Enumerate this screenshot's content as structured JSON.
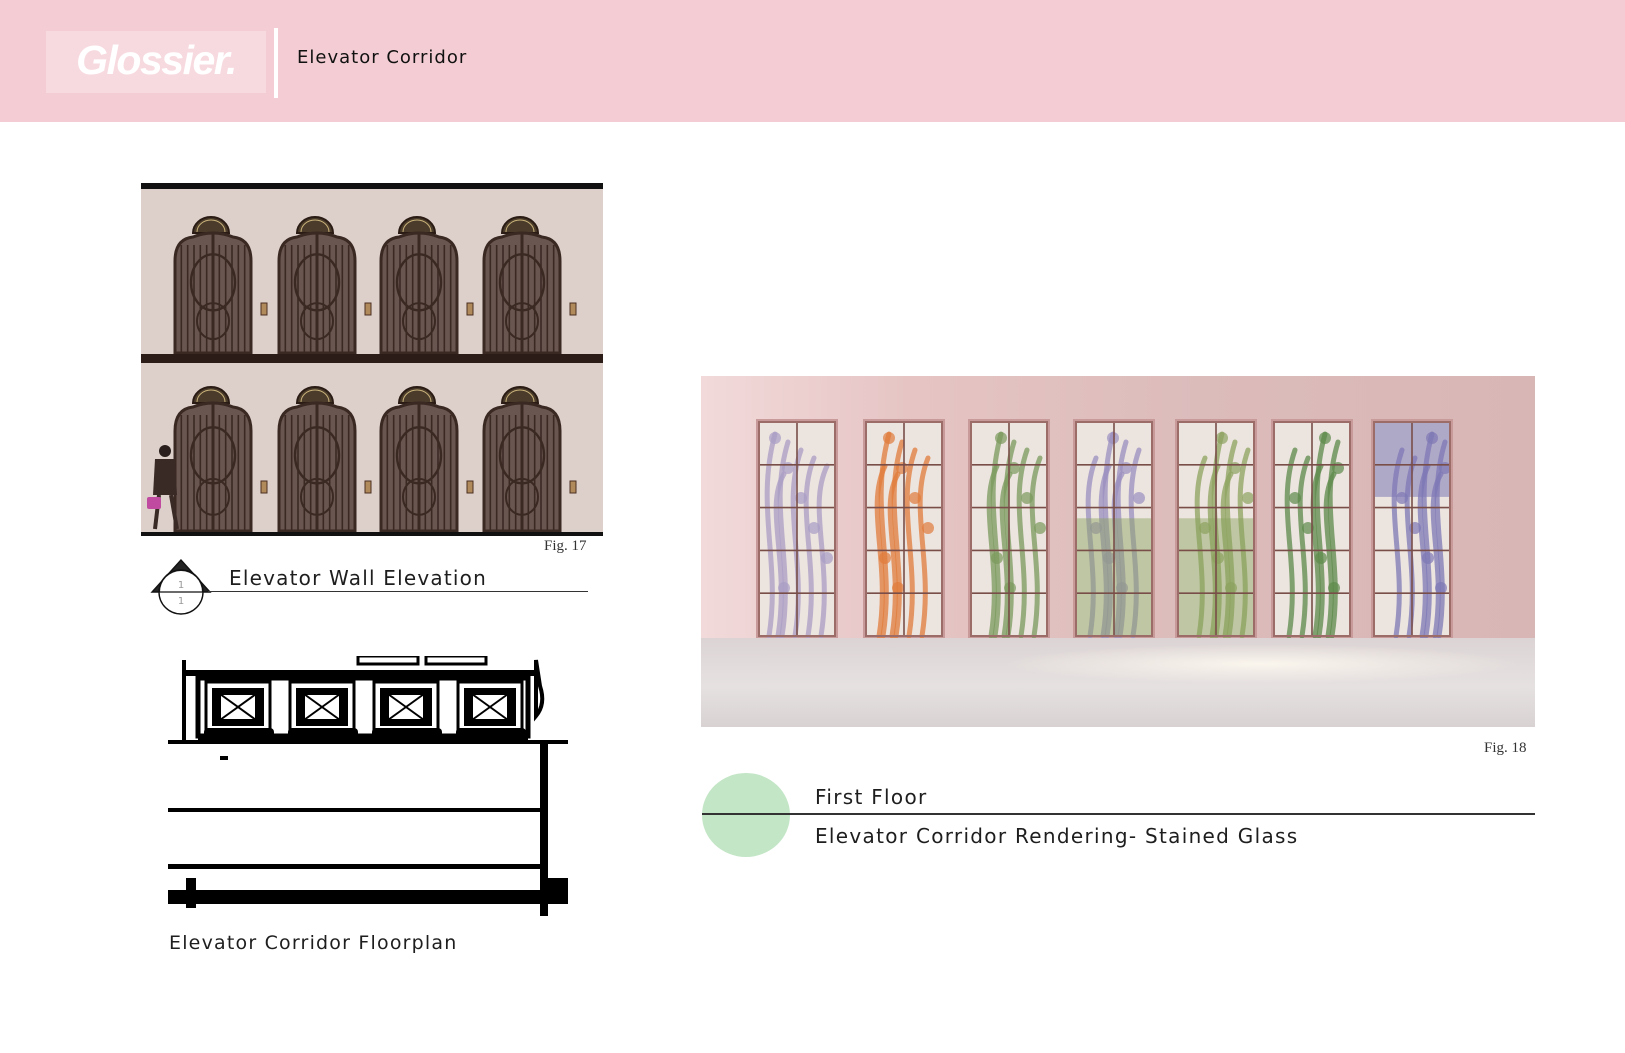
{
  "header": {
    "logo": "Glossier.",
    "title": "Elevator Corridor"
  },
  "elevation": {
    "figure_label": "Fig. 17",
    "title": "Elevator Wall Elevation",
    "section_marker": {
      "top": "1",
      "bottom": "1"
    }
  },
  "floorplan": {
    "title": "Elevator Corridor Floorplan"
  },
  "rendering": {
    "figure_label": "Fig. 18",
    "panels": [
      {
        "plant": "lavender-branch",
        "color": "#a99cc4"
      },
      {
        "plant": "orange-flowers",
        "color": "#e07b3a"
      },
      {
        "plant": "green-leaves",
        "color": "#7a9a5c"
      },
      {
        "plant": "purple-grass",
        "color": "#9a8fbf"
      },
      {
        "plant": "green-meadow",
        "color": "#8da35f"
      },
      {
        "plant": "vine",
        "color": "#5c8a4a"
      },
      {
        "plant": "wisteria",
        "color": "#7e78b5"
      }
    ]
  },
  "caption": {
    "floor": "First Floor",
    "description": "Elevator Corridor Rendering- Stained Glass"
  },
  "colors": {
    "header_bg": "#f3cdd3",
    "accent_green": "#c3e6c6",
    "gate_iron": "#3a2823",
    "wall_pink": "#ddd0cb"
  }
}
